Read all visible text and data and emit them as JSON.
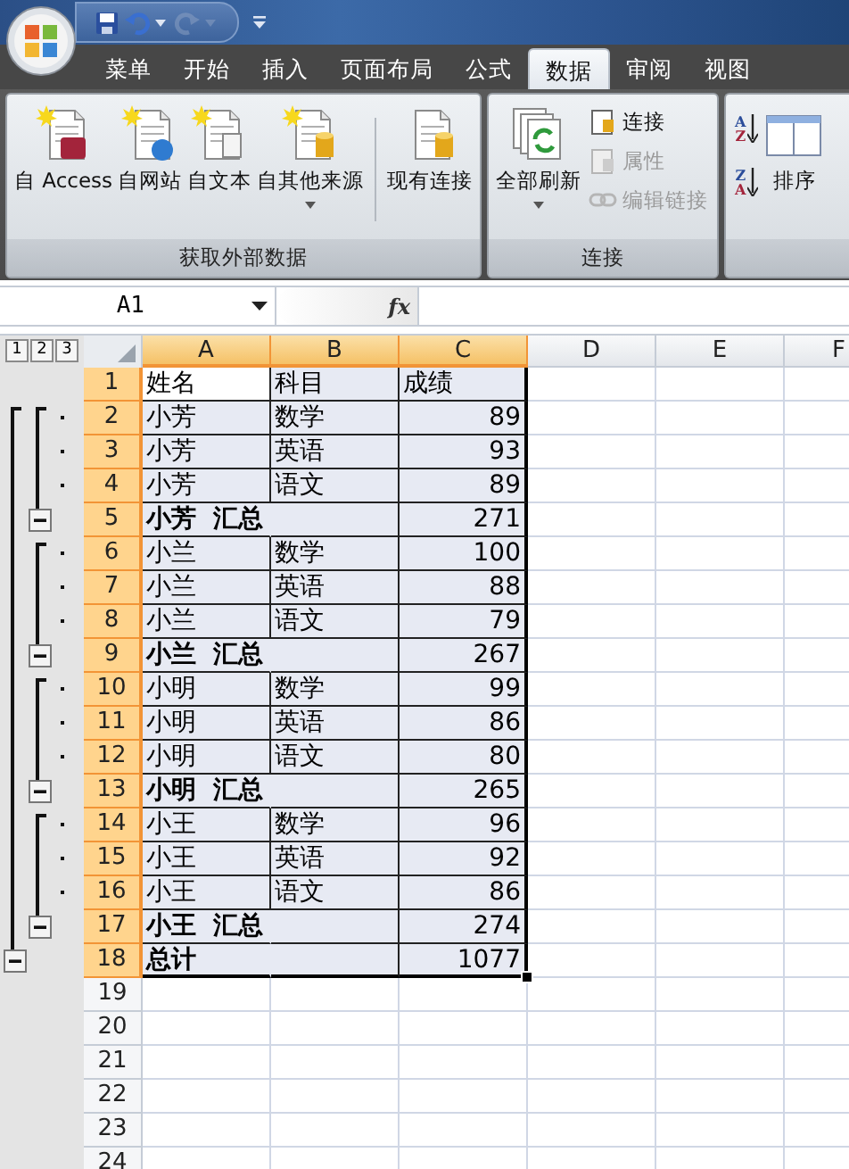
{
  "quick_access": [
    {
      "kind": "save",
      "disabled": false,
      "dropdown": false
    },
    {
      "kind": "undo",
      "disabled": false,
      "dropdown": true
    },
    {
      "kind": "redo",
      "disabled": true,
      "dropdown": true
    }
  ],
  "tabs": [
    {
      "label": "菜单",
      "selected": false
    },
    {
      "label": "开始",
      "selected": false
    },
    {
      "label": "插入",
      "selected": false
    },
    {
      "label": "页面布局",
      "selected": false
    },
    {
      "label": "公式",
      "selected": false
    },
    {
      "label": "数据",
      "selected": true
    },
    {
      "label": "审阅",
      "selected": false
    },
    {
      "label": "视图",
      "selected": false
    }
  ],
  "ribbon_groups": [
    {
      "label": "获取外部数据",
      "buttons": [
        {
          "kind": "large",
          "label": "自 Access",
          "dropdown": false
        },
        {
          "kind": "large",
          "label": "自网站",
          "dropdown": false
        },
        {
          "kind": "large",
          "label": "自文本",
          "dropdown": false
        },
        {
          "kind": "large",
          "label": "自其他来源",
          "dropdown": true
        },
        {
          "kind": "separator"
        },
        {
          "kind": "large",
          "label": "现有连接",
          "dropdown": false
        }
      ]
    },
    {
      "label": "连接",
      "buttons": [
        {
          "kind": "large",
          "label": "全部刷新",
          "dropdown": true
        },
        {
          "kind": "small",
          "label": "连接",
          "disabled": false
        },
        {
          "kind": "small",
          "label": "属性",
          "disabled": true
        },
        {
          "kind": "small",
          "label": "编辑链接",
          "disabled": true
        }
      ]
    },
    {
      "buttons": [
        {
          "kind": "sort",
          "top": "A",
          "bottom": "Z"
        },
        {
          "kind": "sort",
          "top": "Z",
          "bottom": "A"
        },
        {
          "kind": "large",
          "label": "排序",
          "dropdown": false
        }
      ]
    }
  ],
  "formula_bar": {
    "name_box": "A1",
    "insert_function": "fx"
  },
  "outline_levels": [
    "1",
    "2",
    "3"
  ],
  "columns": [
    {
      "label": "A",
      "selected": true
    },
    {
      "label": "B",
      "selected": true
    },
    {
      "label": "C",
      "selected": true
    },
    {
      "label": "D",
      "selected": false
    },
    {
      "label": "E",
      "selected": false
    },
    {
      "label": "F",
      "selected": false
    }
  ],
  "rows": [
    {
      "num": "1",
      "kind": "header",
      "selected": true,
      "cells": [
        "姓名",
        "科目",
        "成绩"
      ]
    },
    {
      "num": "2",
      "kind": "detail",
      "selected": true,
      "cells": [
        "小芳",
        "数学",
        "89"
      ]
    },
    {
      "num": "3",
      "kind": "detail",
      "selected": true,
      "cells": [
        "小芳",
        "英语",
        "93"
      ]
    },
    {
      "num": "4",
      "kind": "detail",
      "selected": true,
      "cells": [
        "小芳",
        "语文",
        "89"
      ]
    },
    {
      "num": "5",
      "kind": "subtotal",
      "selected": true,
      "cells": [
        "小芳  汇总",
        "271"
      ]
    },
    {
      "num": "6",
      "kind": "detail",
      "selected": true,
      "cells": [
        "小兰",
        "数学",
        "100"
      ]
    },
    {
      "num": "7",
      "kind": "detail",
      "selected": true,
      "cells": [
        "小兰",
        "英语",
        "88"
      ]
    },
    {
      "num": "8",
      "kind": "detail",
      "selected": true,
      "cells": [
        "小兰",
        "语文",
        "79"
      ]
    },
    {
      "num": "9",
      "kind": "subtotal",
      "selected": true,
      "cells": [
        "小兰  汇总",
        "267"
      ]
    },
    {
      "num": "10",
      "kind": "detail",
      "selected": true,
      "cells": [
        "小明",
        "数学",
        "99"
      ]
    },
    {
      "num": "11",
      "kind": "detail",
      "selected": true,
      "cells": [
        "小明",
        "英语",
        "86"
      ]
    },
    {
      "num": "12",
      "kind": "detail",
      "selected": true,
      "cells": [
        "小明",
        "语文",
        "80"
      ]
    },
    {
      "num": "13",
      "kind": "subtotal",
      "selected": true,
      "cells": [
        "小明  汇总",
        "265"
      ]
    },
    {
      "num": "14",
      "kind": "detail",
      "selected": true,
      "cells": [
        "小王",
        "数学",
        "96"
      ]
    },
    {
      "num": "15",
      "kind": "detail",
      "selected": true,
      "cells": [
        "小王",
        "英语",
        "92"
      ]
    },
    {
      "num": "16",
      "kind": "detail",
      "selected": true,
      "cells": [
        "小王",
        "语文",
        "86"
      ]
    },
    {
      "num": "17",
      "kind": "subtotal",
      "selected": true,
      "cells": [
        "小王  汇总",
        "274"
      ]
    },
    {
      "num": "18",
      "kind": "total",
      "selected": true,
      "cells": [
        "总计",
        "1077"
      ]
    },
    {
      "num": "19",
      "kind": "empty",
      "selected": false,
      "cells": []
    },
    {
      "num": "20",
      "kind": "empty",
      "selected": false,
      "cells": []
    },
    {
      "num": "21",
      "kind": "empty",
      "selected": false,
      "cells": []
    },
    {
      "num": "22",
      "kind": "empty",
      "selected": false,
      "cells": []
    },
    {
      "num": "23",
      "kind": "empty",
      "selected": false,
      "cells": []
    },
    {
      "num": "24",
      "kind": "empty",
      "selected": false,
      "cells": []
    }
  ]
}
